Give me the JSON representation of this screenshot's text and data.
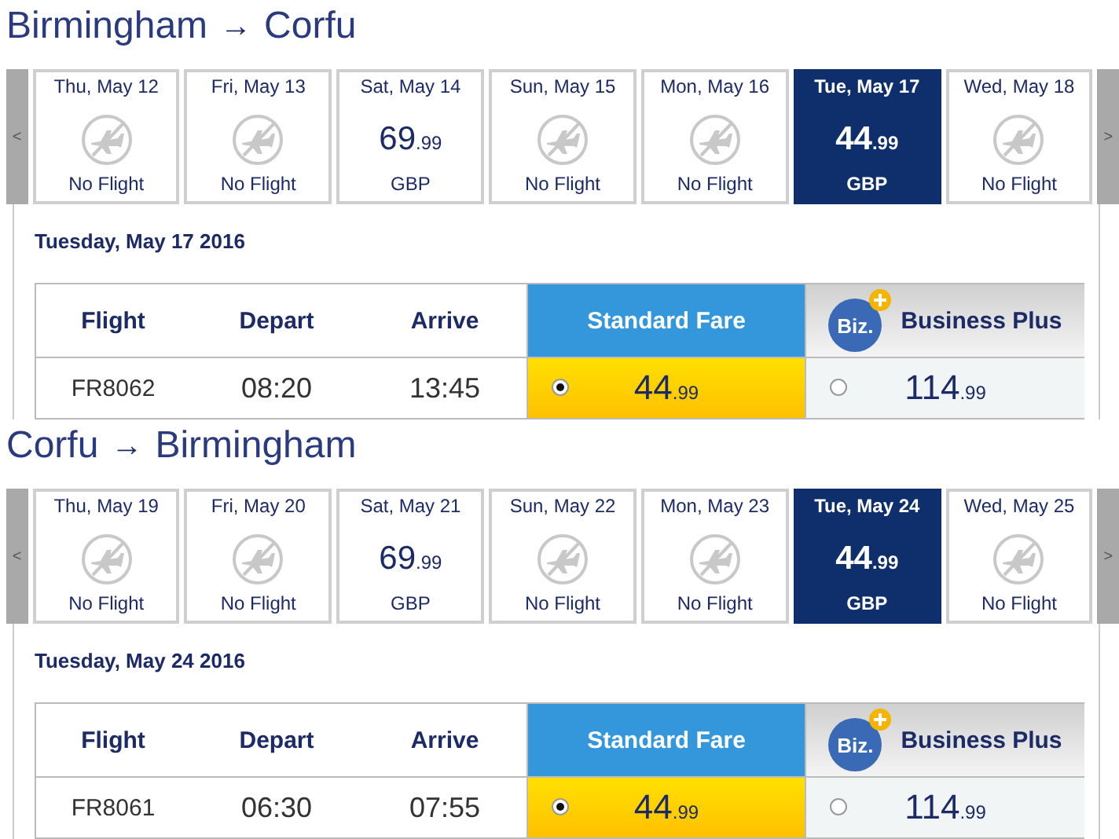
{
  "legs": [
    {
      "title": {
        "from": "Birmingham",
        "arrow": "→",
        "to": "Corfu"
      },
      "prev": "<",
      "next": ">",
      "days": [
        {
          "date": "Thu, May 12",
          "kind": "none",
          "status": "No Flight",
          "selected": false
        },
        {
          "date": "Fri, May 13",
          "kind": "none",
          "status": "No Flight",
          "selected": false
        },
        {
          "date": "Sat, May 14",
          "kind": "price",
          "price": "69",
          "cents": ".99",
          "currency": "GBP",
          "selected": false
        },
        {
          "date": "Sun, May 15",
          "kind": "none",
          "status": "No Flight",
          "selected": false
        },
        {
          "date": "Mon, May 16",
          "kind": "none",
          "status": "No Flight",
          "selected": false
        },
        {
          "date": "Tue, May 17",
          "kind": "price",
          "price": "44",
          "cents": ".99",
          "currency": "GBP",
          "selected": true
        },
        {
          "date": "Wed, May 18",
          "kind": "none",
          "status": "No Flight",
          "selected": false
        }
      ],
      "date_label": "Tuesday, May 17 2016",
      "columns": [
        "Flight",
        "Depart",
        "Arrive"
      ],
      "fares": [
        {
          "kind": "standard",
          "label": "Standard Fare"
        },
        {
          "kind": "business",
          "logo": "Biz.",
          "label": "Business Plus"
        }
      ],
      "flight": {
        "number": "FR8062",
        "depart": "08:20",
        "arrive": "13:45",
        "prices": [
          {
            "price": "44",
            "cents": ".99",
            "selected": true
          },
          {
            "price": "114",
            "cents": ".99",
            "selected": false
          }
        ]
      }
    },
    {
      "title": {
        "from": "Corfu",
        "arrow": "→",
        "to": "Birmingham"
      },
      "prev": "<",
      "next": ">",
      "days": [
        {
          "date": "Thu, May 19",
          "kind": "none",
          "status": "No Flight",
          "selected": false
        },
        {
          "date": "Fri, May 20",
          "kind": "none",
          "status": "No Flight",
          "selected": false
        },
        {
          "date": "Sat, May 21",
          "kind": "price",
          "price": "69",
          "cents": ".99",
          "currency": "GBP",
          "selected": false
        },
        {
          "date": "Sun, May 22",
          "kind": "none",
          "status": "No Flight",
          "selected": false
        },
        {
          "date": "Mon, May 23",
          "kind": "none",
          "status": "No Flight",
          "selected": false
        },
        {
          "date": "Tue, May 24",
          "kind": "price",
          "price": "44",
          "cents": ".99",
          "currency": "GBP",
          "selected": true
        },
        {
          "date": "Wed, May 25",
          "kind": "none",
          "status": "No Flight",
          "selected": false
        }
      ],
      "date_label": "Tuesday, May 24 2016",
      "columns": [
        "Flight",
        "Depart",
        "Arrive"
      ],
      "fares": [
        {
          "kind": "standard",
          "label": "Standard Fare"
        },
        {
          "kind": "business",
          "logo": "Biz.",
          "label": "Business Plus"
        }
      ],
      "flight": {
        "number": "FR8061",
        "depart": "06:30",
        "arrive": "07:55",
        "prices": [
          {
            "price": "44",
            "cents": ".99",
            "selected": true
          },
          {
            "price": "114",
            "cents": ".99",
            "selected": false
          }
        ]
      }
    }
  ]
}
